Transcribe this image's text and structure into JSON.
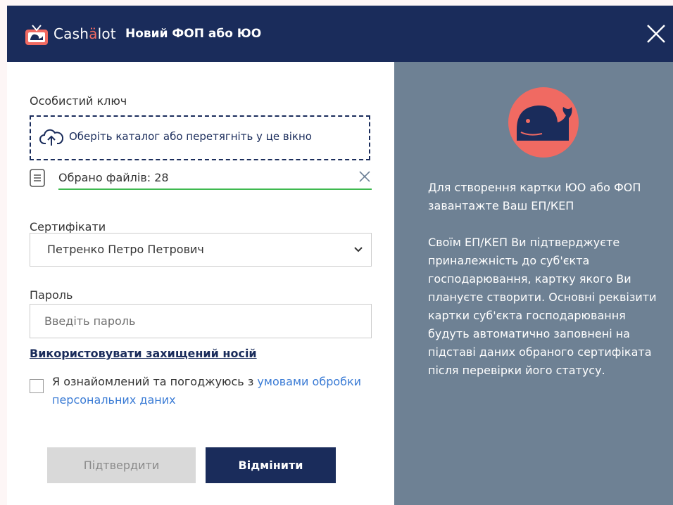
{
  "header": {
    "brand_main": "Cashälot",
    "brand_prefix": "Cash",
    "brand_accent": "ä",
    "brand_suffix": "lot",
    "title": "Новий ФОП або ЮО",
    "close_icon": "close-icon"
  },
  "form": {
    "key_label": "Особистий ключ",
    "dropzone_text": "Оберіть каталог або перетягніть у це вікно",
    "dropzone_icon": "cloud-upload-icon",
    "files_selected": "Обрано файлів: 28",
    "file_icon": "document-icon",
    "clear_icon": "clear-icon",
    "certificates_label": "Сертифікати",
    "certificate_selected": "Петренко Петро Петрович",
    "password_label": "Пароль",
    "password_placeholder": "Введіть пароль",
    "secure_media_link": "Використовувати захищений носій",
    "consent_text": "Я ознайомлений та погоджуюсь з ",
    "consent_link": "умовами обробки персональних даних",
    "consent_checked": false,
    "confirm_button": "Підтвердити",
    "cancel_button": "Відмінити"
  },
  "info": {
    "illustration": "whale-icon",
    "paragraph1": "Для створення картки ЮО або ФОП завантажте Ваш ЕП/КЕП",
    "paragraph2": "Своїм ЕП/КЕП Ви підтверджуєте приналежність до суб'єкта господарювання, картку якого Ви плануєте створити. Основні реквізити картки суб'єкта господарювання будуть автоматично заповнені на підставі даних обраного сертифіката після перевірки його статусу."
  },
  "colors": {
    "header_bg": "#1a2c5b",
    "accent": "#f06a62",
    "panel_bg": "#6e8194",
    "success_line": "#3fb950",
    "link": "#3a7bd5"
  }
}
